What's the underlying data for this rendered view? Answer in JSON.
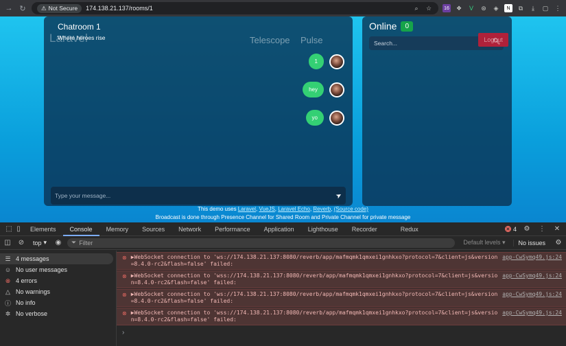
{
  "browser": {
    "security_label": "Not Secure",
    "url": "174.138.21.137/rooms/1",
    "extension_badge": "16"
  },
  "page": {
    "logo_text": "Laravel",
    "nav_telescope": "Telescope",
    "nav_pulse": "Pulse",
    "logout_label": "Logout",
    "chat": {
      "title": "Chatroom 1",
      "subtitle": "Where heroes rise",
      "messages": [
        {
          "text": "1"
        },
        {
          "text": "hey"
        },
        {
          "text": "yo"
        }
      ],
      "input_placeholder": "Type your message..."
    },
    "online": {
      "title": "Online",
      "count": "0",
      "search_placeholder": "Search..."
    },
    "footer": {
      "line1_prefix": "This demo uses",
      "links": [
        "Laravel",
        "VueJS",
        "Laravel Echo",
        "Reverb"
      ],
      "source_link": "(Source code)",
      "line2": "Broadcast is done through Presence Channel for Shared Room and Private Channel for private message"
    }
  },
  "devtools": {
    "tabs": [
      "Elements",
      "Console",
      "Memory",
      "Sources",
      "Network",
      "Performance",
      "Application",
      "Lighthouse",
      "Recorder",
      "Redux"
    ],
    "active_tab": "Console",
    "error_count": "4",
    "context": "top",
    "filter_placeholder": "Filter",
    "levels": "Default levels",
    "issues": "No issues",
    "sidebar": [
      {
        "label": "4 messages",
        "icon": "list-icon"
      },
      {
        "label": "No user messages",
        "icon": "user-icon"
      },
      {
        "label": "4 errors",
        "icon": "error-icon"
      },
      {
        "label": "No warnings",
        "icon": "warning-icon"
      },
      {
        "label": "No info",
        "icon": "info-icon"
      },
      {
        "label": "No verbose",
        "icon": "bug-icon"
      }
    ],
    "logs": [
      {
        "text": "▶WebSocket connection to 'ws://174.138.21.137:8080/reverb/app/mafmqmk1qmxei1gnhkxo?protocol=7&client=js&version=8.4.0-rc2&flash=false' failed:",
        "source": "app-CwSymq49.js:24"
      },
      {
        "text": "▶WebSocket connection to 'wss://174.138.21.137:8080/reverb/app/mafmqmk1qmxei1gnhkxo?protocol=7&client=js&version=8.4.0-rc2&flash=false' failed:",
        "source": "app-CwSymq49.js:24"
      },
      {
        "text": "▶WebSocket connection to 'ws://174.138.21.137:8080/reverb/app/mafmqmk1qmxei1gnhkxo?protocol=7&client=js&version=8.4.0-rc2&flash=false' failed:",
        "source": "app-CwSymq49.js:24"
      },
      {
        "text": "▶WebSocket connection to 'wss://174.138.21.137:8080/reverb/app/mafmqmk1qmxei1gnhkxo?protocol=7&client=js&version=8.4.0-rc2&flash=false' failed:",
        "source": "app-CwSymq49.js:24"
      }
    ]
  }
}
